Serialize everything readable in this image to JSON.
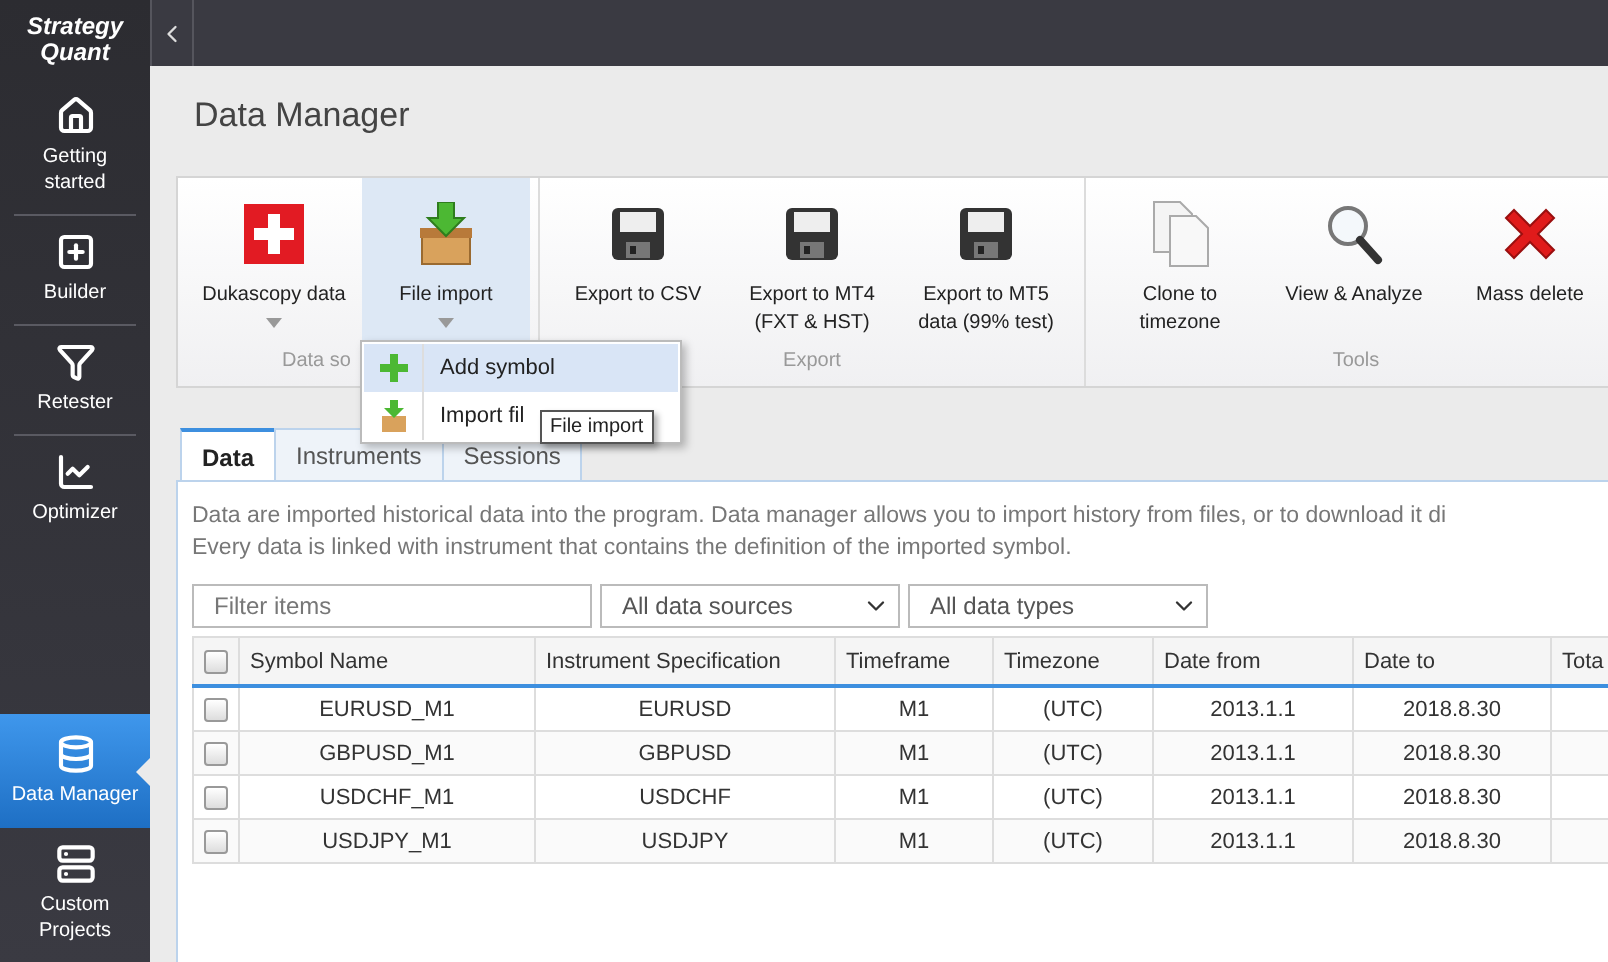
{
  "logo": {
    "lines": [
      "Strategy",
      "Quant"
    ]
  },
  "sidebar": {
    "items": [
      {
        "label": "Getting started",
        "selected": false
      },
      {
        "label": "Builder",
        "selected": false
      },
      {
        "label": "Retester",
        "selected": false
      },
      {
        "label": "Optimizer",
        "selected": false
      },
      {
        "label": "Data Manager",
        "selected": true
      },
      {
        "label": "Custom Projects",
        "selected": false
      }
    ]
  },
  "page_title": "Data Manager",
  "ribbon": {
    "groups": [
      {
        "label": "Data so",
        "buttons": [
          {
            "lines": [
              "Dukascopy data"
            ],
            "dropdown": true,
            "selected": false
          },
          {
            "lines": [
              "File import"
            ],
            "dropdown": true,
            "selected": true
          }
        ]
      },
      {
        "label": "Export",
        "buttons": [
          {
            "lines": [
              "Export to CSV"
            ],
            "dropdown": false,
            "selected": false
          },
          {
            "lines": [
              "Export to MT4",
              "(FXT & HST)"
            ],
            "dropdown": false,
            "selected": false
          },
          {
            "lines": [
              "Export to MT5",
              "data (99% test)"
            ],
            "dropdown": false,
            "selected": false
          }
        ]
      },
      {
        "label": "Tools",
        "buttons": [
          {
            "lines": [
              "Clone to",
              "timezone"
            ],
            "dropdown": false,
            "selected": false
          },
          {
            "lines": [
              "View & Analyze"
            ],
            "dropdown": false,
            "selected": false
          },
          {
            "lines": [
              "Mass delete"
            ],
            "dropdown": false,
            "selected": false
          }
        ]
      }
    ]
  },
  "menu": {
    "items": [
      {
        "label": "Add symbol",
        "selected": true
      },
      {
        "label": "Import fil",
        "selected": false
      }
    ],
    "tooltip": "File import"
  },
  "tabs": [
    {
      "label": "Data",
      "selected": true
    },
    {
      "label": "Instruments",
      "selected": false
    },
    {
      "label": "Sessions",
      "selected": false
    }
  ],
  "description": [
    "Data are imported historical data into the program. Data manager allows you to import history from files, or to download it di",
    "Every data is linked with instrument that contains the definition of the imported symbol."
  ],
  "filters": {
    "search": {
      "placeholder": "Filter items"
    },
    "selects": [
      "All data sources",
      "All data types"
    ]
  },
  "table": {
    "header_checked": false,
    "columns": [
      "Symbol Name",
      "Instrument Specification",
      "Timeframe",
      "Timezone",
      "Date from",
      "Date to",
      "Tota"
    ],
    "rows": [
      {
        "checked": false,
        "cells": [
          "EURUSD_M1",
          "EURUSD",
          "M1",
          "(UTC)",
          "2013.1.1",
          "2018.8.30"
        ]
      },
      {
        "checked": false,
        "cells": [
          "GBPUSD_M1",
          "GBPUSD",
          "M1",
          "(UTC)",
          "2013.1.1",
          "2018.8.30"
        ]
      },
      {
        "checked": false,
        "cells": [
          "USDCHF_M1",
          "USDCHF",
          "M1",
          "(UTC)",
          "2013.1.1",
          "2018.8.30"
        ]
      },
      {
        "checked": false,
        "cells": [
          "USDJPY_M1",
          "USDJPY",
          "M1",
          "(UTC)",
          "2013.1.1",
          "2018.8.30"
        ]
      }
    ]
  }
}
